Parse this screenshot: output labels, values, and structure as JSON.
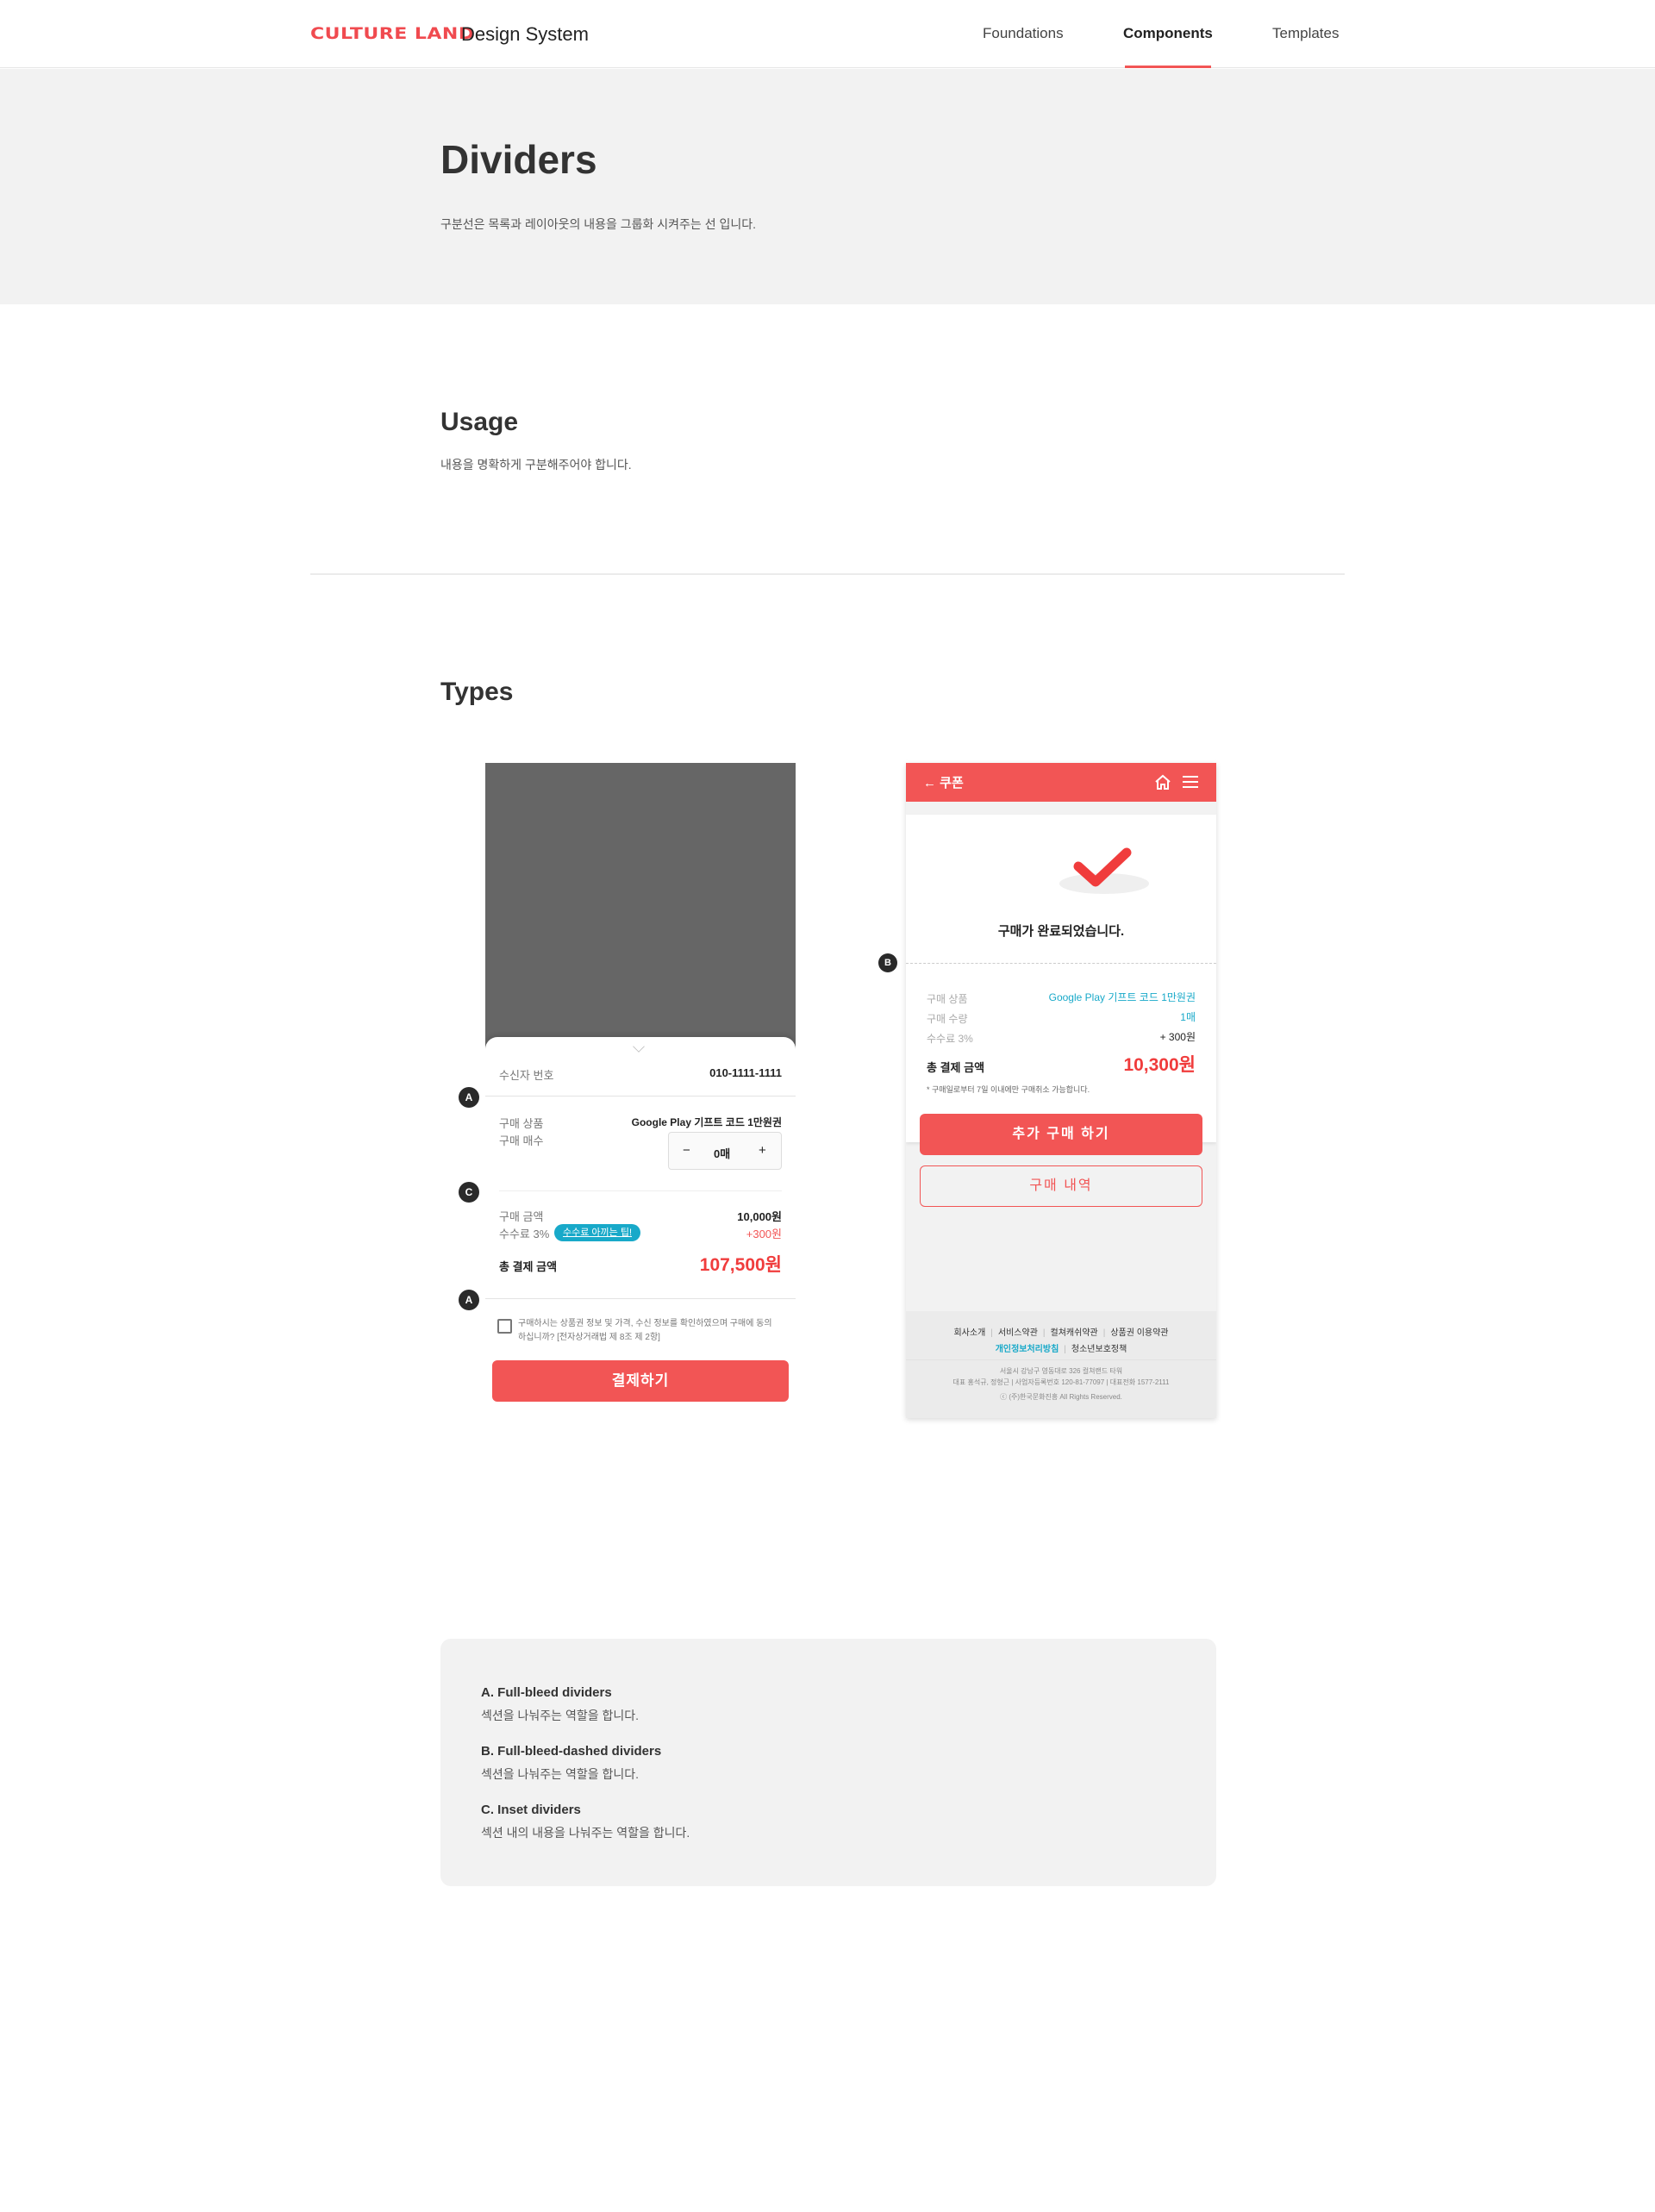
{
  "header": {
    "logo": "CULTURE LAND",
    "brand": "Design System",
    "nav": [
      {
        "label": "Foundations",
        "active": false
      },
      {
        "label": "Components",
        "active": true
      },
      {
        "label": "Templates",
        "active": false
      }
    ],
    "accent_color": "#f25555"
  },
  "hero": {
    "title": "Dividers",
    "description": "구분선은 목록과 레이아웃의 내용을 그룹화 시켜주는 선 입니다."
  },
  "usage": {
    "title": "Usage",
    "description": "내용을 명확하게 구분해주어야 합니다."
  },
  "types": {
    "title": "Types",
    "left_example": {
      "recipient_label": "수신자 번호",
      "recipient_value": "010-1111-1111",
      "product_label": "구매 상품",
      "product_value": "Google Play 기프트 코드 1만원권",
      "count_label": "구매 매수",
      "stepper": {
        "minus": "−",
        "value": "0매",
        "plus": "+"
      },
      "amount_label": "구매 금액",
      "amount_value": "10,000원",
      "fee_label": "수수료 3%",
      "fee_tip": "수수료 아끼는 팁!",
      "fee_value": "+300원",
      "total_label": "총 결제 금액",
      "total_value": "107,500원",
      "agree_text_1": "구매하시는 상품권 정보 및 가격, 수신 정보를 확인하였으며 구매에 동의",
      "agree_text_2": "하십니까? [전자상거래법 제 8조 제 2항]",
      "pay_button": "결제하기",
      "badges": [
        "A",
        "C",
        "A"
      ]
    },
    "right_example": {
      "appbar_title": "쿠폰",
      "complete_message": "구매가 완료되었습니다.",
      "rows": [
        {
          "label": "구매 상품",
          "value": "Google Play 기프트 코드 1만원권"
        },
        {
          "label": "구매 수량",
          "value": "1매"
        },
        {
          "label": "수수료 3%",
          "value": "+ 300원"
        }
      ],
      "total_label": "총 결제 금액",
      "total_value": "10,300원",
      "notice": "* 구매일로부터 7일 이내에만 구매취소 가능합니다.",
      "primary_button": "추가 구매 하기",
      "secondary_button": "구매 내역",
      "footer_links_row1": [
        "회사소개",
        "서비스약관",
        "컬쳐캐쉬약관",
        "상품권 이용약관"
      ],
      "footer_links_row2": [
        "개인정보처리방침",
        "청소년보호정책"
      ],
      "footer_address": "서울시 강남구 영동대로 326 컬쳐랜드 타워",
      "footer_info": "대표 홍석규, 정형근  |  사업자등록번호 120-81-77097  |  대표전화 1577-2111",
      "footer_copyright": "ⓒ (주)한국문화진흥 All Rights Reserved.",
      "badge": "B"
    }
  },
  "legend": {
    "items": [
      {
        "title": "A.  Full-bleed dividers",
        "desc": "섹션을 나눠주는 역할을 합니다."
      },
      {
        "title": "B.  Full-bleed-dashed dividers",
        "desc": "섹션을 나눠주는 역할을 합니다."
      },
      {
        "title": "C. Inset dividers",
        "desc": "섹션 내의 내용을 나눠주는 역할을 합니다."
      }
    ]
  }
}
